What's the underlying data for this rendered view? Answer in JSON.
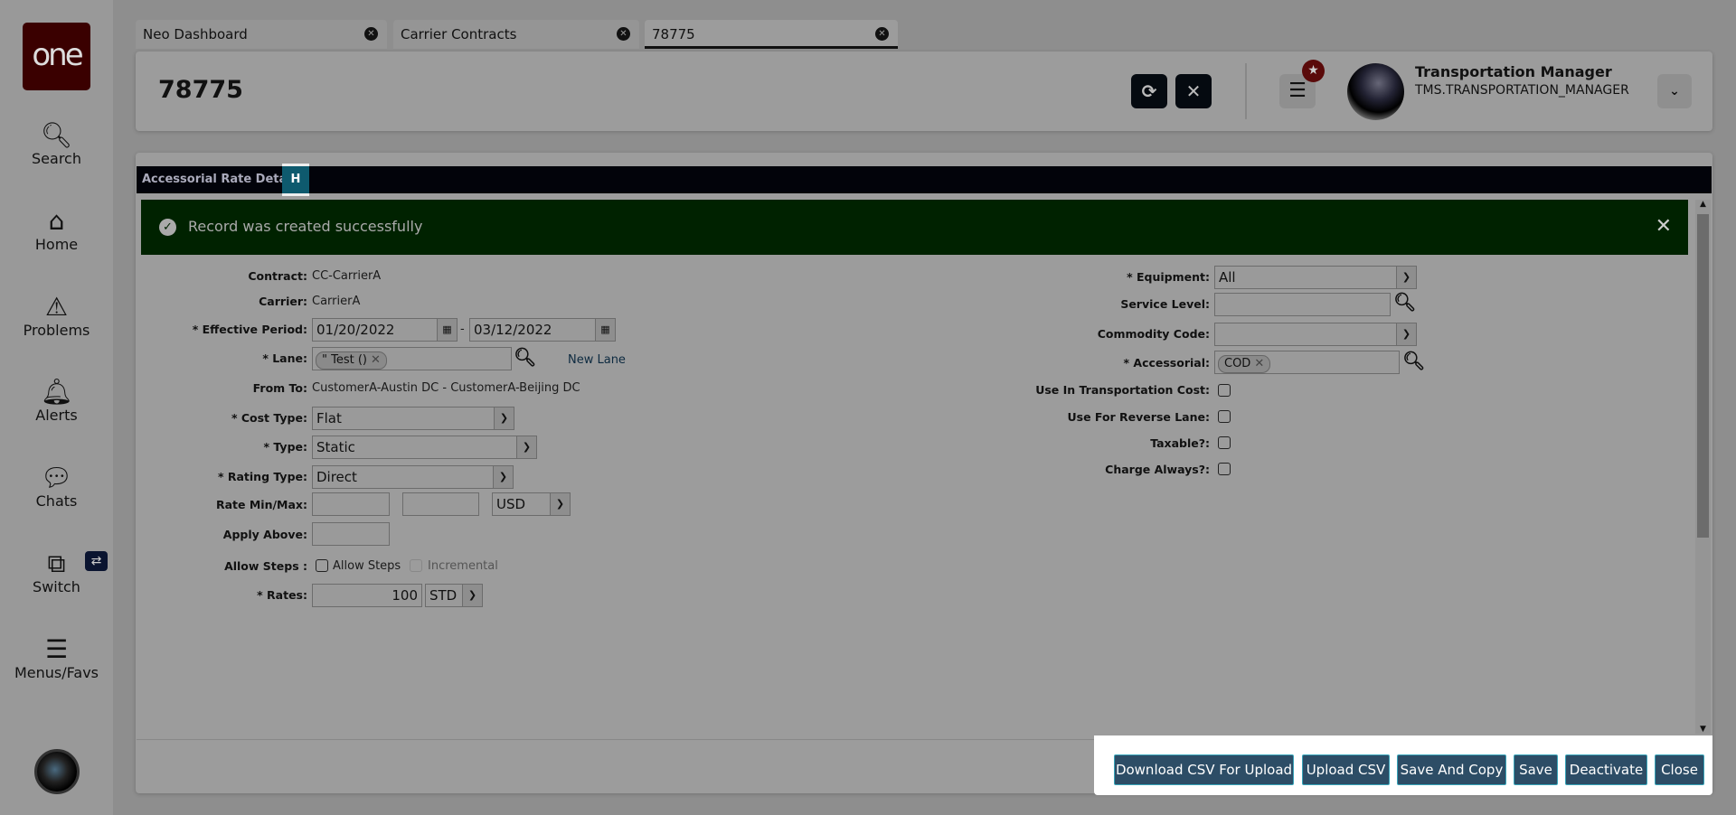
{
  "sidebar": {
    "logo": "one",
    "items": [
      {
        "label": "Search",
        "icon": "search-icon"
      },
      {
        "label": "Home",
        "icon": "home-icon"
      },
      {
        "label": "Problems",
        "icon": "warning-icon"
      },
      {
        "label": "Alerts",
        "icon": "bell-icon"
      },
      {
        "label": "Chats",
        "icon": "chat-icon"
      },
      {
        "label": "Switch",
        "icon": "switch-icon"
      },
      {
        "label": "Menus/Favs",
        "icon": "menu-icon"
      }
    ]
  },
  "tabs": [
    {
      "label": "Neo Dashboard"
    },
    {
      "label": "Carrier Contracts"
    },
    {
      "label": "78775",
      "active": true
    }
  ],
  "header": {
    "title": "78775",
    "user_name": "Transportation Manager",
    "user_role": "TMS.TRANSPORTATION_MANAGER"
  },
  "section": {
    "title": "Accessorial Rate Detail",
    "tab_h": "H"
  },
  "banner": {
    "message": "Record was created successfully",
    "color": "#002200"
  },
  "form_left": {
    "contract_label": "Contract:",
    "contract": "CC-CarrierA",
    "carrier_label": "Carrier:",
    "carrier": "CarrierA",
    "effective_label": "* Effective Period:",
    "eff_from": "01/20/2022",
    "eff_sep": "-",
    "eff_to": "03/12/2022",
    "lane_label": "* Lane:",
    "lane_chip": "\" Test ()",
    "new_lane": "New Lane",
    "fromto_label": "From To:",
    "fromto": "CustomerA-Austin DC - CustomerA-Beijing DC",
    "cost_type_label": "* Cost Type:",
    "cost_type": "Flat",
    "type_label": "* Type:",
    "type": "Static",
    "rating_type_label": "* Rating Type:",
    "rating_type": "Direct",
    "rate_minmax_label": "Rate Min/Max:",
    "rate_min": "",
    "rate_max": "",
    "currency": "USD",
    "apply_above_label": "Apply Above:",
    "apply_above": "",
    "allow_steps_label": "Allow Steps :",
    "allow_steps_cb": "Allow Steps",
    "incremental_cb": "Incremental",
    "rates_label": "* Rates:",
    "rates": "100",
    "rates_unit": "STD"
  },
  "form_right": {
    "equipment_label": "* Equipment:",
    "equipment": "All",
    "service_level_label": "Service Level:",
    "service_level": "",
    "commodity_label": "Commodity Code:",
    "commodity": "",
    "accessorial_label": "* Accessorial:",
    "accessorial_chip": "COD",
    "use_transport_label": "Use In Transportation Cost:",
    "reverse_lane_label": "Use For Reverse Lane:",
    "taxable_label": "Taxable?:",
    "charge_always_label": "Charge Always?:"
  },
  "footer": {
    "download": "Download CSV For Upload",
    "upload": "Upload CSV",
    "save_copy": "Save And Copy",
    "save": "Save",
    "deactivate": "Deactivate",
    "close": "Close"
  }
}
